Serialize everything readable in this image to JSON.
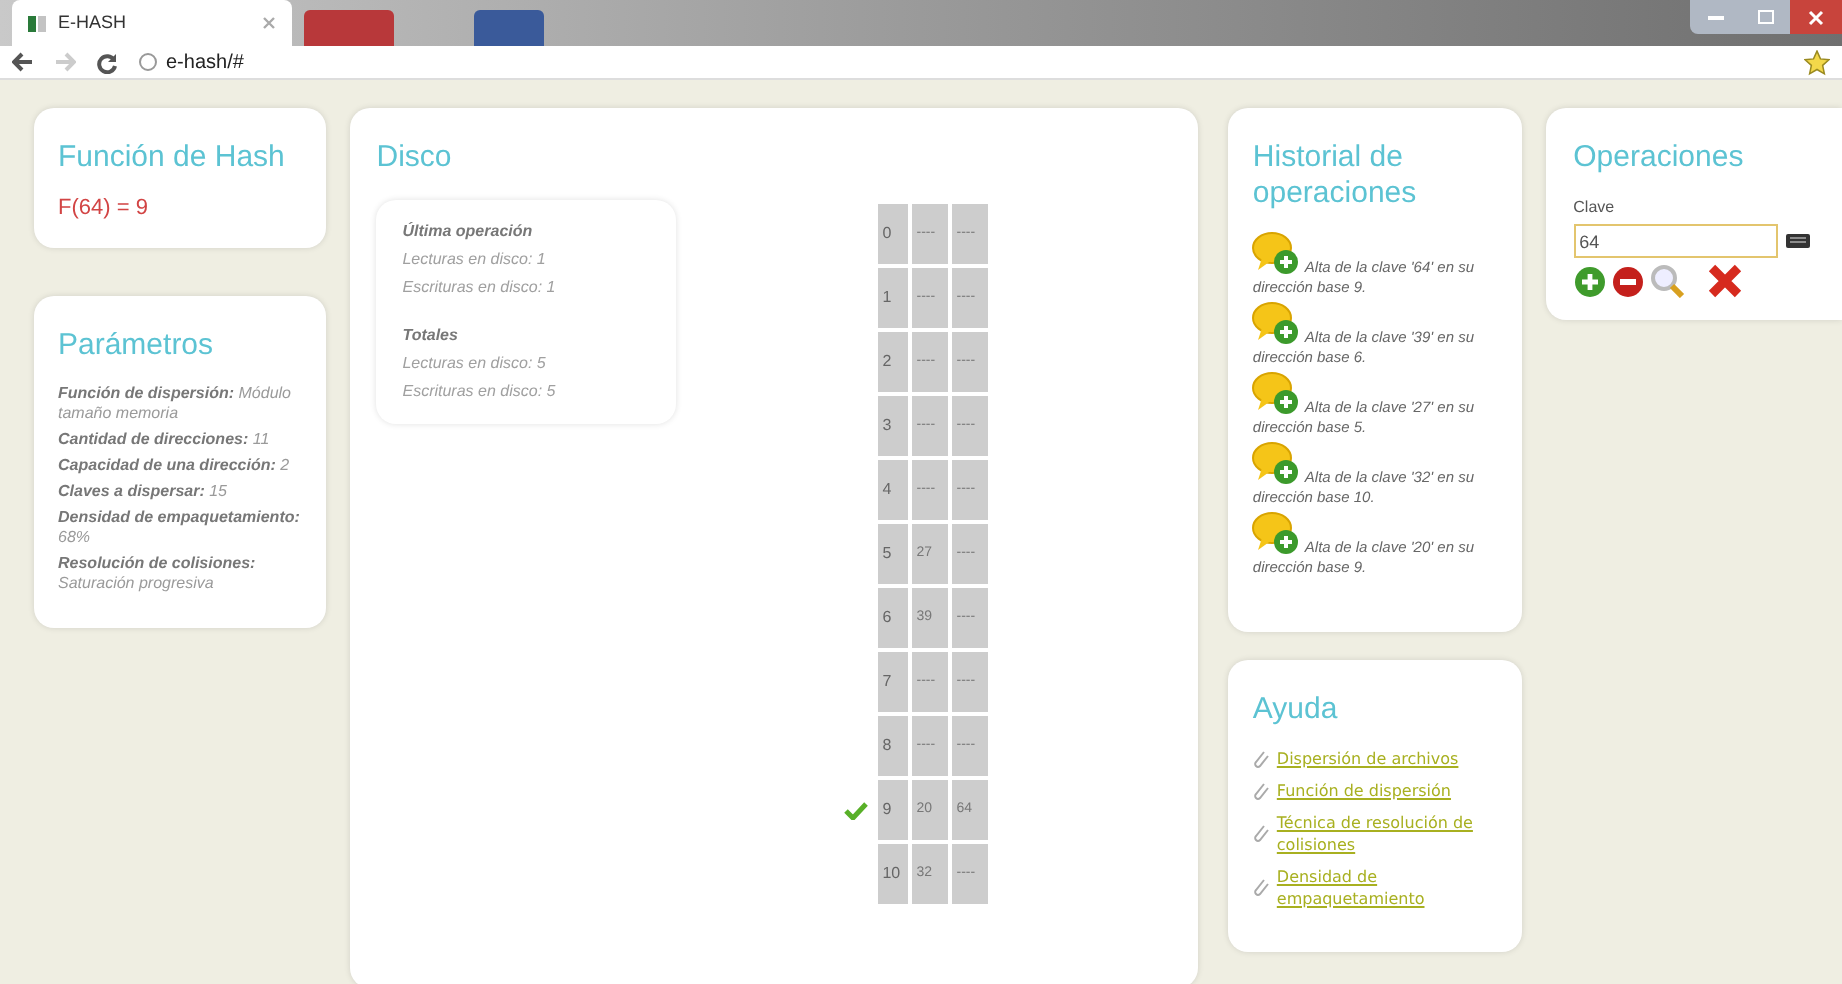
{
  "browser": {
    "tab_title": "E-HASH",
    "address": "e-hash/#"
  },
  "hash_function": {
    "title": "Función de Hash",
    "result": "F(64) = 9"
  },
  "parameters": {
    "title": "Parámetros",
    "items": [
      {
        "label": "Función de dispersión:",
        "value": "Módulo tamaño memoria"
      },
      {
        "label": "Cantidad de direcciones:",
        "value": "11"
      },
      {
        "label": "Capacidad de una dirección:",
        "value": "2"
      },
      {
        "label": "Claves a dispersar:",
        "value": "15"
      },
      {
        "label": "Densidad de empaquetamiento:",
        "value": "68%"
      },
      {
        "label": "Resolución de colisiones:",
        "value": "Saturación progresiva"
      }
    ]
  },
  "disk": {
    "title": "Disco",
    "stats": [
      {
        "heading": "Última operación",
        "lines": [
          "Lecturas en disco: 1",
          "Escrituras en disco: 1"
        ]
      },
      {
        "heading": "Totales",
        "lines": [
          "Lecturas en disco: 5",
          "Escrituras en disco: 5"
        ]
      }
    ],
    "rows": [
      {
        "address": "0",
        "slots": [
          "----",
          "----"
        ],
        "marked": false
      },
      {
        "address": "1",
        "slots": [
          "----",
          "----"
        ],
        "marked": false
      },
      {
        "address": "2",
        "slots": [
          "----",
          "----"
        ],
        "marked": false
      },
      {
        "address": "3",
        "slots": [
          "----",
          "----"
        ],
        "marked": false
      },
      {
        "address": "4",
        "slots": [
          "----",
          "----"
        ],
        "marked": false
      },
      {
        "address": "5",
        "slots": [
          "27",
          "----"
        ],
        "marked": false
      },
      {
        "address": "6",
        "slots": [
          "39",
          "----"
        ],
        "marked": false
      },
      {
        "address": "7",
        "slots": [
          "----",
          "----"
        ],
        "marked": false
      },
      {
        "address": "8",
        "slots": [
          "----",
          "----"
        ],
        "marked": false
      },
      {
        "address": "9",
        "slots": [
          "20",
          "64"
        ],
        "marked": true
      },
      {
        "address": "10",
        "slots": [
          "32",
          "----"
        ],
        "marked": false
      }
    ]
  },
  "history": {
    "title": "Historial de operaciones",
    "items": [
      "Alta de la clave '64' en su dirección base 9.",
      "Alta de la clave '39' en su dirección base 6.",
      "Alta de la clave '27' en su dirección base 5.",
      "Alta de la clave '32' en su dirección base 10.",
      "Alta de la clave '20' en su dirección base 9."
    ]
  },
  "help": {
    "title": "Ayuda",
    "links": [
      "Dispersión de archivos",
      "Función de dispersión",
      "Técnica de resolución de colisiones",
      "Densidad de empaquetamiento"
    ]
  },
  "operations": {
    "title": "Operaciones",
    "key_label": "Clave",
    "key_value": "64"
  }
}
